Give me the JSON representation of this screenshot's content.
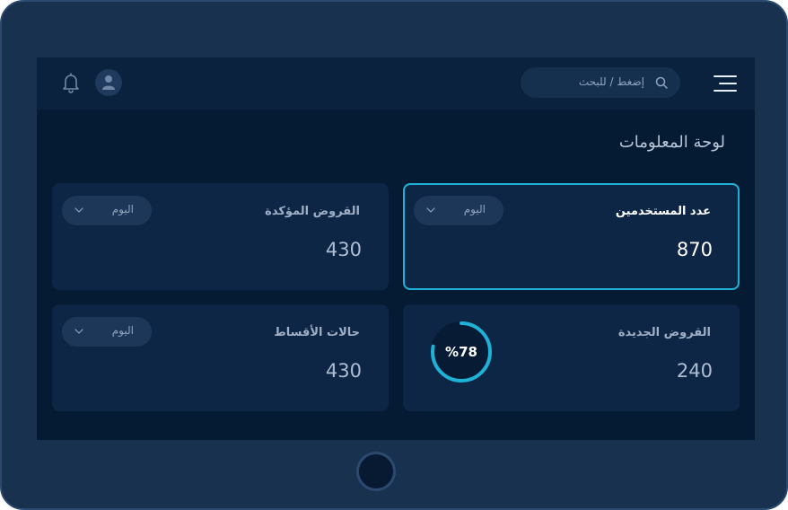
{
  "header": {
    "search_placeholder": "إضغط / للبحث",
    "icons": {
      "menu": "hamburger-menu-icon",
      "search": "search-icon",
      "avatar": "user-avatar-icon",
      "notifications": "bell-icon"
    }
  },
  "page": {
    "title": "لوحة المعلومات"
  },
  "cards": [
    {
      "title": "عدد المستخدمين",
      "value": "870",
      "period": "اليوم",
      "active": true
    },
    {
      "title": "القروض المؤكدة",
      "value": "430",
      "period": "اليوم",
      "active": false
    },
    {
      "title": "القروض الجديدة",
      "value": "240",
      "progress_label": "%78",
      "progress": 0.78,
      "active": false
    },
    {
      "title": "حالات الأقساط",
      "value": "430",
      "period": "اليوم",
      "active": false
    }
  ],
  "colors": {
    "accent": "#1eb3d6",
    "background": "#051a33",
    "card": "#0e2645",
    "frame": "#17314f"
  }
}
